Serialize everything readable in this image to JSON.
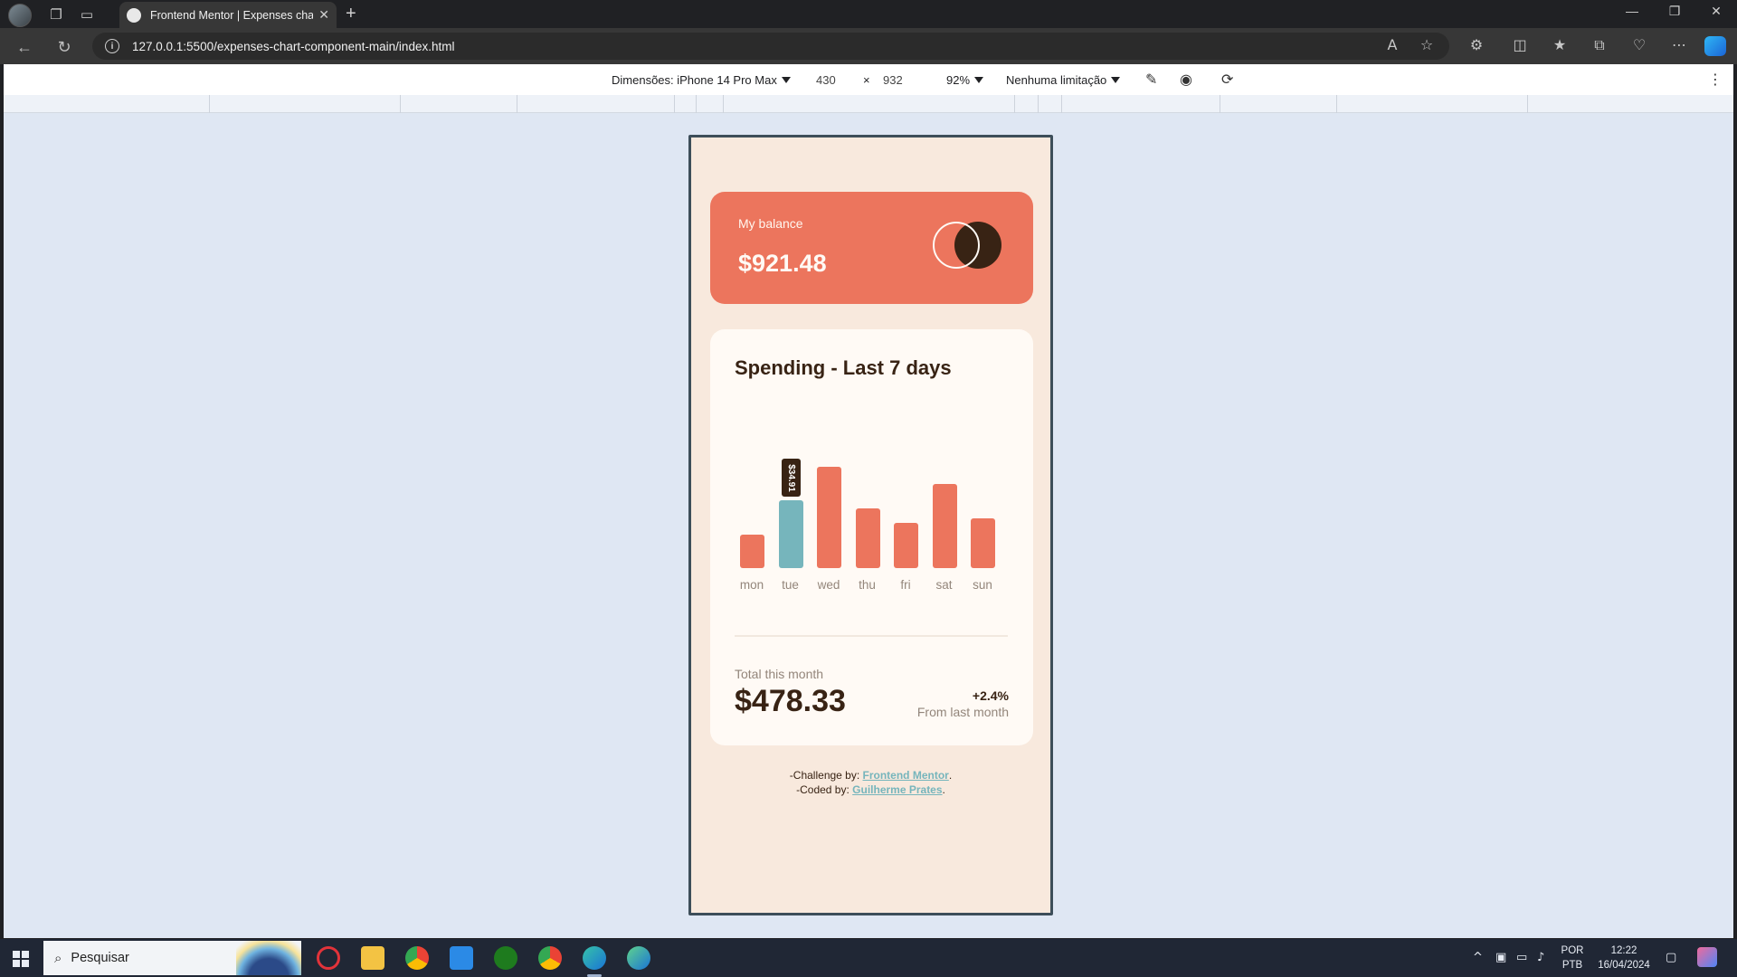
{
  "browser": {
    "tab_title": "Frontend Mentor | Expenses chart component",
    "url": "127.0.0.1:5500/expenses-chart-component-main/index.html"
  },
  "devtools": {
    "dimensions_label": "Dimensões: iPhone 14 Pro Max",
    "width": "430",
    "times": "×",
    "height": "932",
    "zoom": "92%",
    "throttle": "Nenhuma limitação"
  },
  "card": {
    "balance_label": "My balance",
    "balance_amount": "$921.48",
    "spending_title": "Spending - Last 7 days",
    "tooltip": "$34.91",
    "total_label": "Total this month",
    "total_amount": "$478.33",
    "change_pct": "+2.4%",
    "change_label": "From last month"
  },
  "chart_data": {
    "type": "bar",
    "categories": [
      "mon",
      "tue",
      "wed",
      "thu",
      "fri",
      "sat",
      "sun"
    ],
    "values": [
      17.45,
      34.91,
      52.36,
      31.07,
      23.39,
      43.28,
      25.48
    ],
    "highlight": "tue",
    "bar_color": "#ec755d",
    "highlight_color": "#76b5bc"
  },
  "attribution": {
    "challenge_prefix": "-Challenge by: ",
    "challenge_link": "Frontend Mentor",
    "coded_prefix": "-Coded by: ",
    "coded_link": "Guilherme Prates",
    "period": "."
  },
  "taskbar": {
    "search_placeholder": "Pesquisar",
    "lang_top": "POR",
    "lang_bottom": "PTB",
    "time": "12:22",
    "date": "16/04/2024"
  },
  "colors": {
    "accent": "#ec755d",
    "cyan": "#76b5bc",
    "dark": "#382314",
    "card_bg": "#fffaf5",
    "page_bg": "#f8e9dd"
  }
}
